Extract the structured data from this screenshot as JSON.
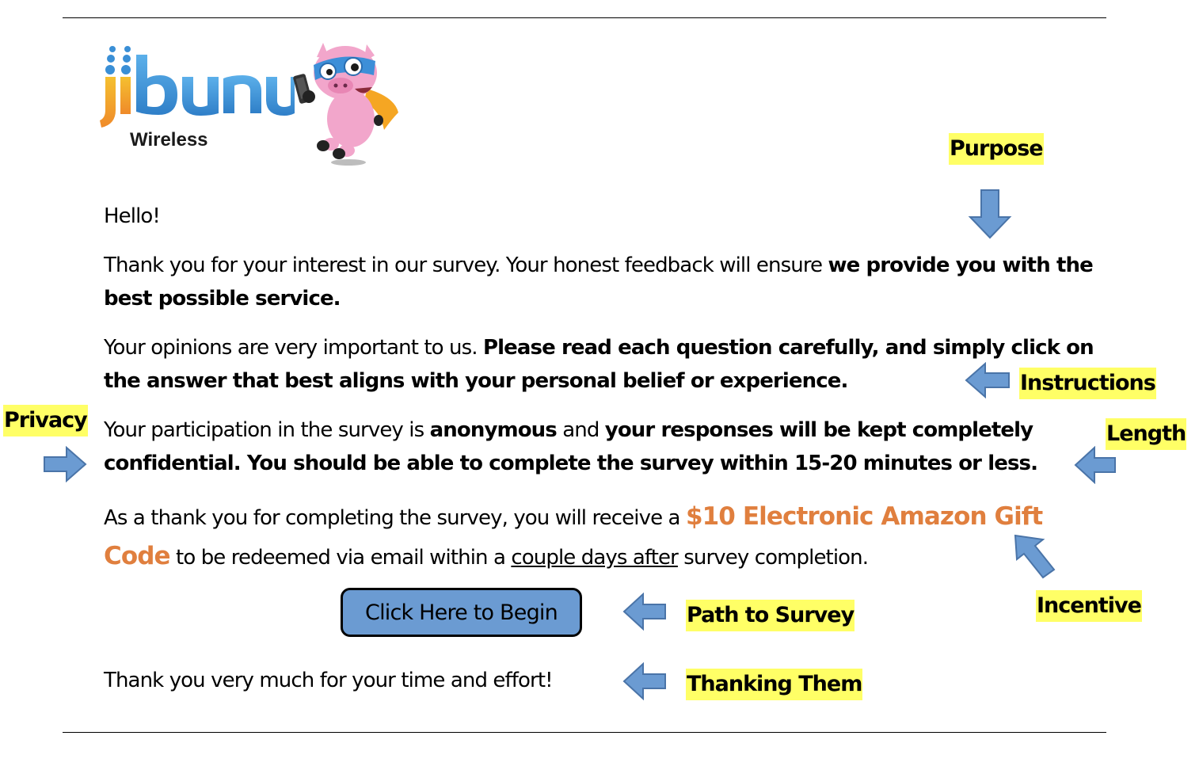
{
  "brand": {
    "logo_text": "jibunu",
    "tagline": "Wireless",
    "colors": {
      "logo_blue": "#3a8fd6",
      "logo_orange": "#f0a030",
      "mascot_pink": "#f0a0c8"
    }
  },
  "email": {
    "greeting": "Hello!",
    "purpose": {
      "text": "Thank you for your interest in our survey. Your honest feedback will ensure ",
      "bold": "we provide you with the best possible service."
    },
    "instructions": {
      "text": "Your opinions are very important to us. ",
      "bold": "Please read each question carefully, and simply click on the answer that best aligns with your personal belief or experience."
    },
    "privacy": {
      "t1": "Your participation in the survey is ",
      "b1": "anonymous",
      "t2": " and ",
      "b2": "your responses will be kept completely confidential. You should be able to complete the survey within 15-20 minutes or less."
    },
    "incentive": {
      "t1": "As a thank you for completing the survey, you will receive a ",
      "highlight": "$10 Electronic Amazon Gift Code",
      "t2": " to be redeemed via email within a ",
      "underline": "couple days after",
      "t3": " survey completion."
    },
    "cta_label": "Click Here to Begin",
    "closing": "Thank you very much for your time and effort!"
  },
  "annotations": {
    "purpose": "Purpose",
    "instructions": "Instructions",
    "privacy": "Privacy",
    "length": "Length",
    "incentive": "Incentive",
    "path": "Path to Survey",
    "thanks": "Thanking Them"
  },
  "colors": {
    "annotation_highlight": "#ffff66",
    "arrow_fill": "#6b9bd2",
    "arrow_stroke": "#4a74a8",
    "incentive_orange": "#e07f3e",
    "button_fill": "#6b9bd2"
  }
}
